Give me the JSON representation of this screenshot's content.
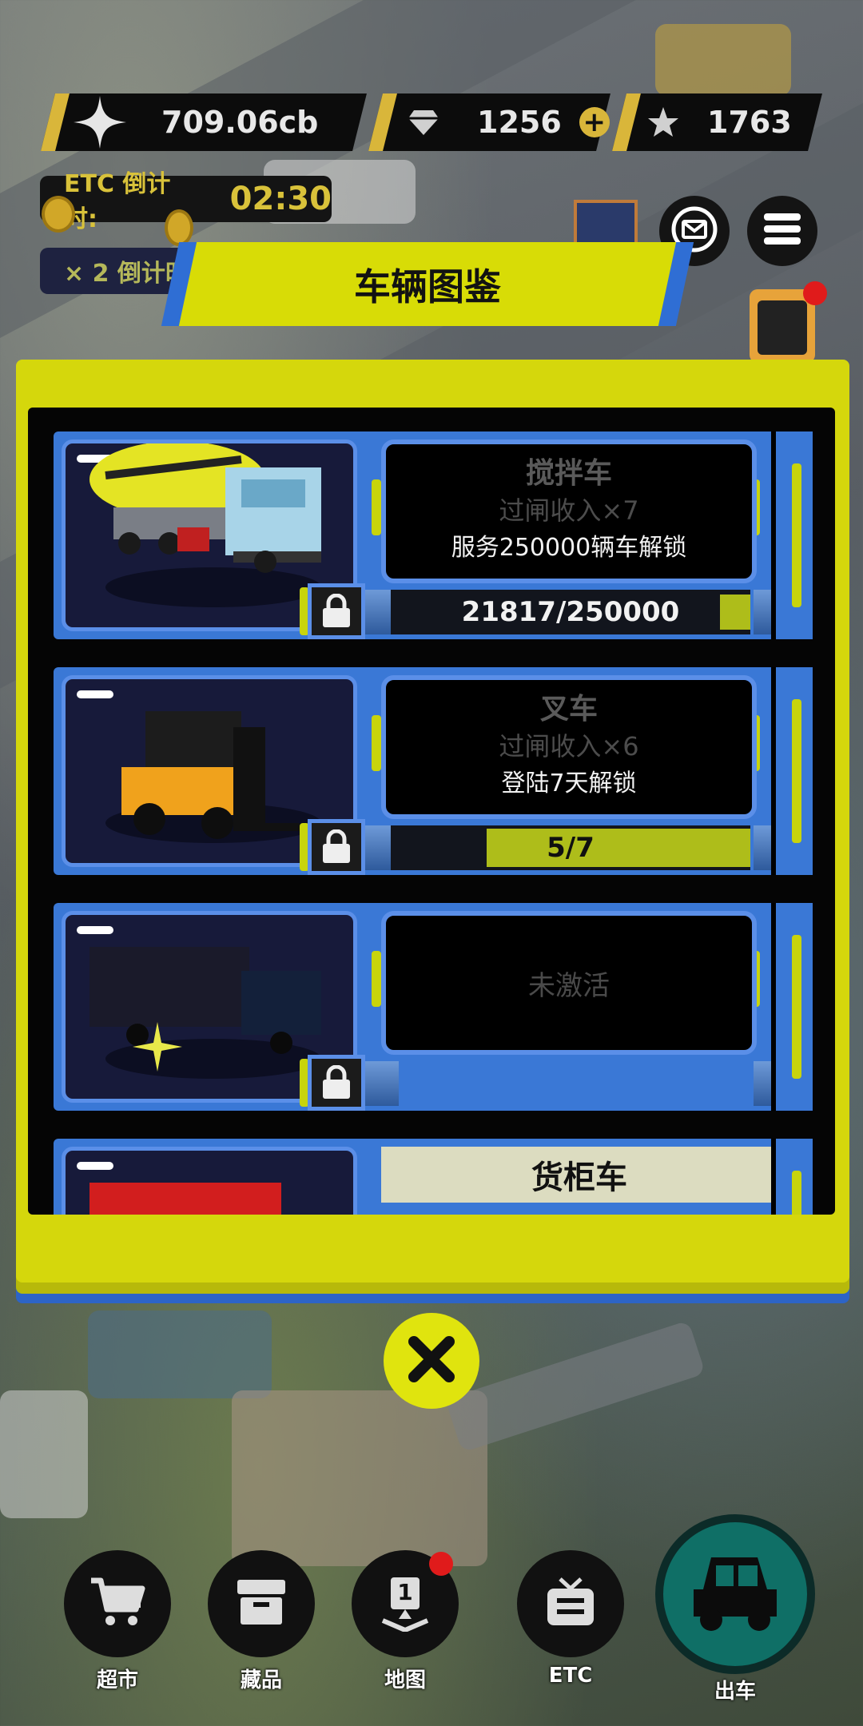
{
  "currency": {
    "coins": "709.06cb",
    "gems": "1256",
    "stars": "1763"
  },
  "timers": {
    "etc_label": "ETC 倒计时:",
    "etc_value": "02:30",
    "multiplier_label": "× 2 倒计时"
  },
  "dialog": {
    "title": "车辆图鉴"
  },
  "vehicles": [
    {
      "name": "搅拌车",
      "income": "过闸收入×7",
      "unlock": "服务250000辆车解锁",
      "progress_text": "21817/250000",
      "progress": 0.087
    },
    {
      "name": "叉车",
      "income": "过闸收入×6",
      "unlock": "登陆7天解锁",
      "progress_text": "5/7",
      "progress": 0.714
    },
    {
      "status": "未激活"
    },
    {
      "name": "货柜车"
    }
  ],
  "nav": {
    "market": "超市",
    "collection": "藏品",
    "map": "地图",
    "map_badge": "1",
    "etc": "ETC",
    "depart": "出车"
  },
  "colors": {
    "panel_yellow": "#d5d70c",
    "card_blue": "#3a78d6",
    "progress_fill": "#aebd1a",
    "depart_teal": "#0f6f66",
    "badge_red": "#e01b1b"
  },
  "icons": {
    "coin": "sparkle-icon",
    "gem": "diamond-icon",
    "star": "star-icon",
    "mail": "mail-icon",
    "menu": "menu-icon",
    "lock": "lock-icon",
    "close": "close-icon",
    "market": "cart-icon",
    "collection": "box-icon",
    "map": "map-pin-icon",
    "etc": "tv-icon",
    "depart": "car-icon"
  }
}
